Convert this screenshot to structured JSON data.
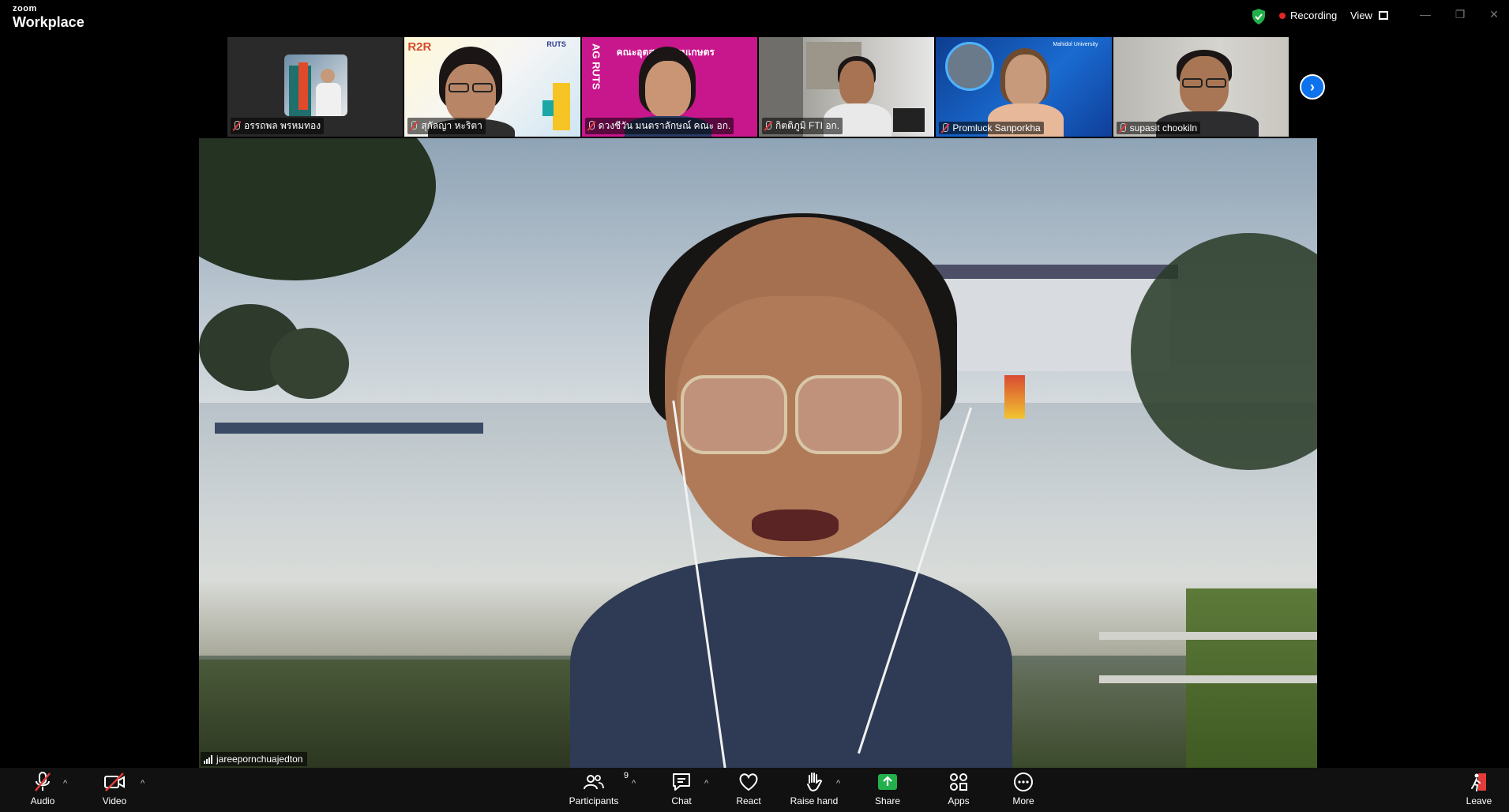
{
  "app": {
    "brand_small": "zoom",
    "brand_name": "Workplace"
  },
  "titlebar": {
    "recording_label": "Recording",
    "view_label": "View"
  },
  "participants_strip": [
    {
      "name": "อรรถพล พรหมทอง"
    },
    {
      "name": "สุกัลญา หะริตา"
    },
    {
      "name": "ดวงชีวัน มนตราลักษณ์ คณะ อก."
    },
    {
      "name": "กิตติภูมิ FTI อก."
    },
    {
      "name": "Promluck Sanporkha"
    },
    {
      "name": "supasit chookiln"
    }
  ],
  "tile_texts": {
    "r2r": "R2R",
    "ruts": "RUTS",
    "ag_ruts": "AG RUTS",
    "faculty_banner": "คณะอุตสาหกรรมเกษตร",
    "mahidol": "Mahidol University"
  },
  "main_video": {
    "speaker_name": "jareepornchuajedton"
  },
  "toolbar": {
    "audio": "Audio",
    "video": "Video",
    "participants": "Participants",
    "participants_count": "9",
    "chat": "Chat",
    "react": "React",
    "raise_hand": "Raise hand",
    "share": "Share",
    "apps": "Apps",
    "more": "More",
    "leave": "Leave"
  },
  "colors": {
    "accent_blue": "#0e72ed",
    "share_green": "#22b04b",
    "record_red": "#e02828",
    "mute_red": "#e23b3b"
  }
}
